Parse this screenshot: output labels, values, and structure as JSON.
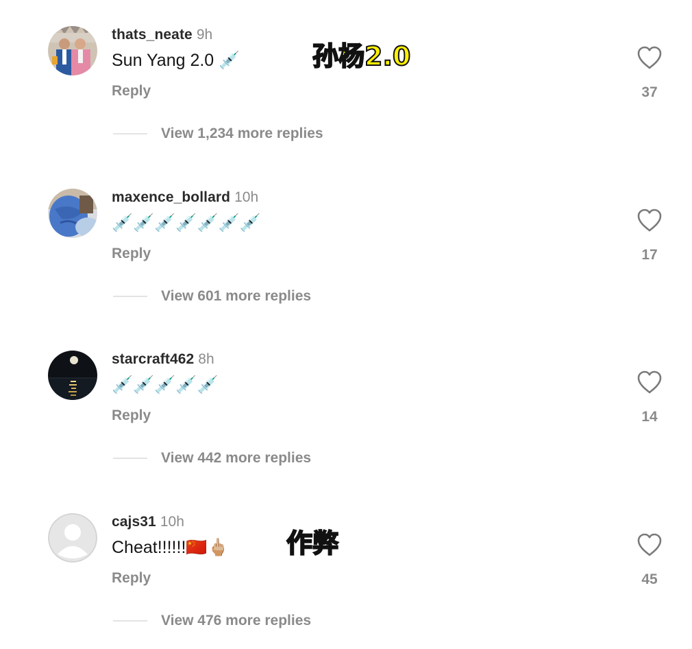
{
  "comments": [
    {
      "username": "thats_neate",
      "time": "9h",
      "body": "Sun Yang 2.0 💉",
      "overlay": "孙杨2.0",
      "reply_label": "Reply",
      "like_count": "37",
      "view_replies": "View 1,234 more replies",
      "avatar": "avatar-photo-two-men-in-suits"
    },
    {
      "username": "maxence_bollard",
      "time": "10h",
      "body": "💉💉💉💉💉💉💉",
      "overlay": "",
      "reply_label": "Reply",
      "like_count": "17",
      "view_replies": "View 601 more replies",
      "avatar": "avatar-photo-blue-shirt"
    },
    {
      "username": "starcraft462",
      "time": "8h",
      "body": "💉💉💉💉💉",
      "overlay": "",
      "reply_label": "Reply",
      "like_count": "14",
      "view_replies": "View 442 more replies",
      "avatar": "avatar-photo-moon-over-sea"
    },
    {
      "username": "cajs31",
      "time": "10h",
      "body": "Cheat!!!!!!🇨🇳🖕🏼",
      "overlay": "作弊",
      "reply_label": "Reply",
      "like_count": "45",
      "view_replies": "View 476 more replies",
      "avatar": "avatar-default-placeholder"
    }
  ],
  "colors": {
    "text_primary": "#161616",
    "text_secondary": "#8a8a8a",
    "overlay_fill": "#fff200",
    "overlay_stroke": "#111111",
    "divider": "#e3e3e3"
  }
}
